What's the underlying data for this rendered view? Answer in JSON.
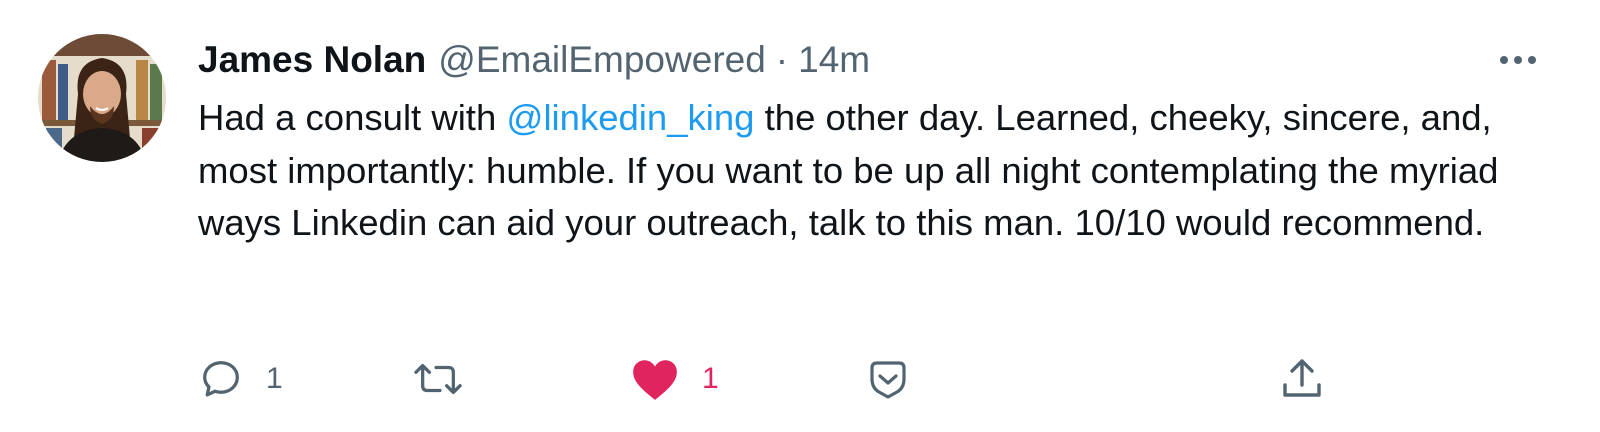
{
  "tweet": {
    "author": {
      "display_name": "James Nolan",
      "handle": "@EmailEmpowered",
      "avatar": "profile-photo"
    },
    "separator": "·",
    "timestamp": "14m",
    "text": {
      "part1": "Had a consult with ",
      "mention": "@linkedin_king",
      "part2": " the other day. Learned, cheeky, sincere, and, most importantly: humble. If you want to be up all night contemplating the myriad ways Linkedin can aid your outreach, talk to this man. 10/10 would recommend."
    },
    "more_icon": "ellipsis-icon",
    "actions": {
      "reply": {
        "icon": "reply-icon",
        "count": "1"
      },
      "retweet": {
        "icon": "retweet-icon",
        "count": ""
      },
      "like": {
        "icon": "heart-icon",
        "count": "1",
        "liked": true
      },
      "save": {
        "icon": "bookmark-icon"
      },
      "share": {
        "icon": "share-icon"
      }
    }
  },
  "colors": {
    "text": "#0f1419",
    "secondary": "#536471",
    "mention": "#1d9bf0",
    "like": "#e0245e"
  }
}
